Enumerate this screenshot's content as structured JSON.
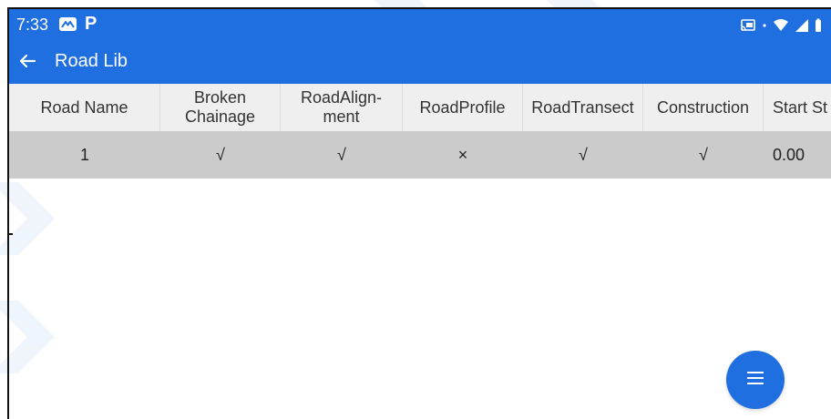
{
  "status_bar": {
    "time": "7:33",
    "left_icons": [
      "mail-icon",
      "p-icon"
    ],
    "right_icons": [
      "cast-icon",
      "wifi-icon",
      "signal-icon",
      "battery-icon"
    ]
  },
  "app_bar": {
    "title": "Road Lib",
    "back_icon": "arrow-back-icon",
    "color": "#1f6fe0"
  },
  "table": {
    "headers": [
      "Road Name",
      "Broken Chainage",
      "RoadAlign-ment",
      "RoadProfile",
      "RoadTransect",
      "Construction",
      "Start St"
    ],
    "header_lines": [
      [
        "Road Name"
      ],
      [
        "Broken",
        "Chainage"
      ],
      [
        "RoadAlign-",
        "ment"
      ],
      [
        "RoadProfile"
      ],
      [
        "RoadTransect"
      ],
      [
        "Construction"
      ],
      [
        "Start St"
      ]
    ],
    "rows": [
      {
        "road_name": "1",
        "broken_chainage": "√",
        "road_alignment": "√",
        "road_profile": "×",
        "road_transect": "√",
        "construction": "√",
        "start": "0.00"
      }
    ],
    "header_bg": "#efefef",
    "selected_row_bg": "#cbcbcb"
  },
  "fab": {
    "icon": "menu-icon",
    "color": "#1f6fe0"
  }
}
